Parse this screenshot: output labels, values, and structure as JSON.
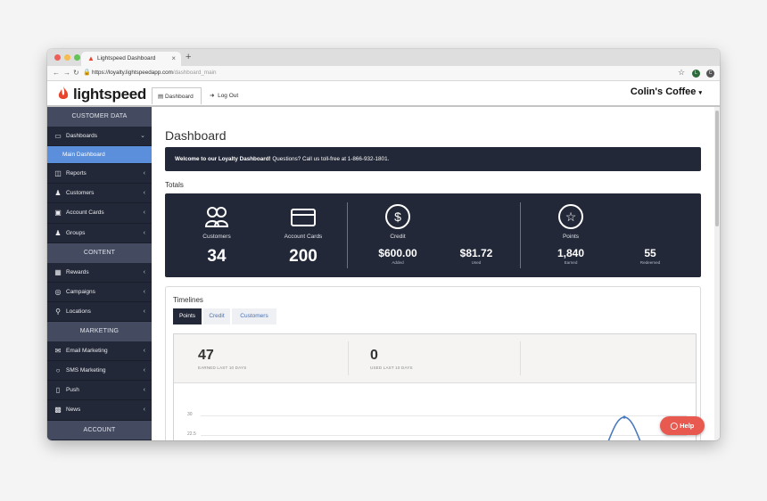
{
  "browser": {
    "tab_title": "Lightspeed Dashboard",
    "url_host": "https://loyalty.lightspeedapp.com",
    "url_path": "/dashboard_main",
    "ext1": "L",
    "ext2": "C"
  },
  "header": {
    "logo": "lightspeed",
    "tab_dashboard": "Dashboard",
    "tab_logout": "Log Out",
    "store": "Colin's Coffee"
  },
  "sidebar": {
    "sec_customer": "CUSTOMER DATA",
    "dashboards": "Dashboards",
    "main_dashboard": "Main Dashboard",
    "reports": "Reports",
    "customers": "Customers",
    "account_cards": "Account Cards",
    "groups": "Groups",
    "sec_content": "CONTENT",
    "rewards": "Rewards",
    "campaigns": "Campaigns",
    "locations": "Locations",
    "sec_marketing": "MARKETING",
    "email_marketing": "Email Marketing",
    "sms_marketing": "SMS Marketing",
    "push": "Push",
    "news": "News",
    "sec_account": "ACCOUNT"
  },
  "main": {
    "title": "Dashboard",
    "welcome_bold": "Welcome to our Loyalty Dashboard!",
    "welcome_rest": " Questions? Call us toll-free at 1-866-932-1801.",
    "totals_heading": "Totals",
    "customers_label": "Customers",
    "customers_value": "34",
    "cards_label": "Account Cards",
    "cards_value": "200",
    "credit_label": "Credit",
    "credit_added": "$600.00",
    "credit_added_sub": "Added",
    "credit_used": "$81.72",
    "credit_used_sub": "Used",
    "points_label": "Points",
    "points_earned": "1,840",
    "points_earned_sub": "Earned",
    "points_redeemed": "55",
    "points_redeemed_sub": "Redeemed",
    "timelines_title": "Timelines",
    "tab_points": "Points",
    "tab_credit": "Credit",
    "tab_customers": "Customers",
    "kpi_earned": "47",
    "kpi_earned_sub": "EARNED LAST 10 DAYS",
    "kpi_used": "0",
    "kpi_used_sub": "USED LAST 10 DAYS",
    "y30": "30",
    "y225": "22.5",
    "help": "Help"
  }
}
